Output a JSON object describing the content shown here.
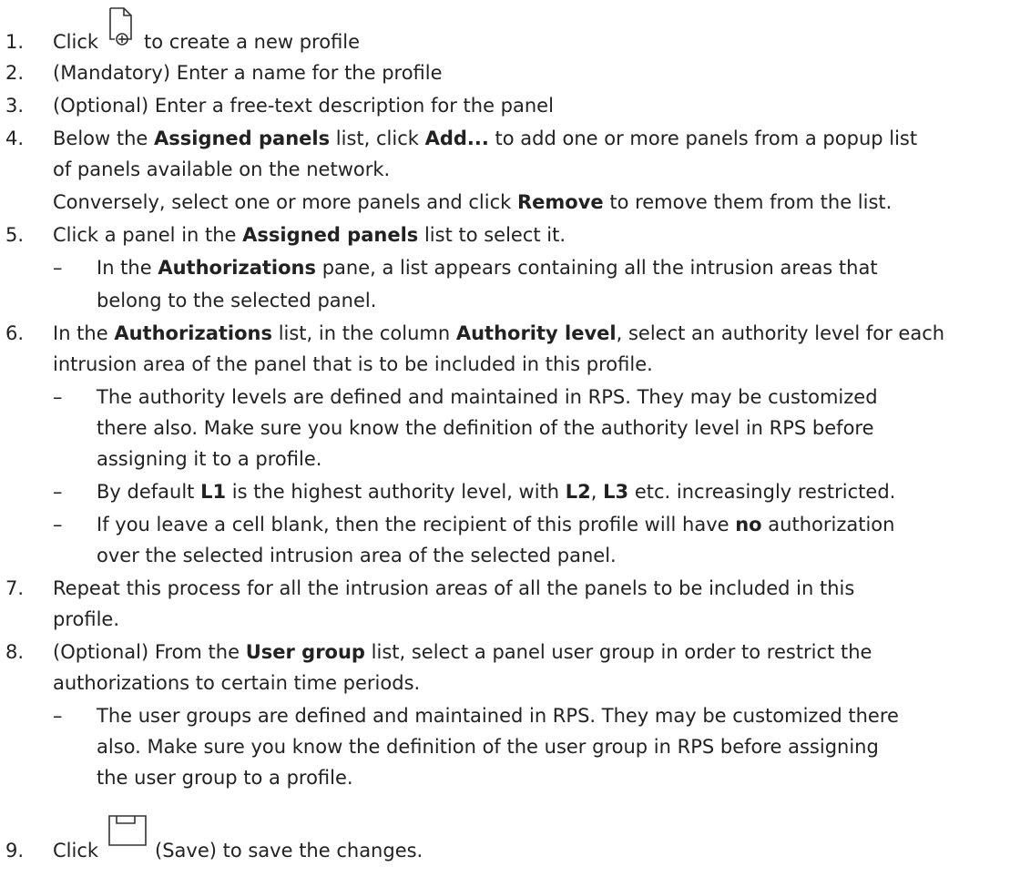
{
  "steps": [
    {
      "num": "1.",
      "parts": {
        "a": "Click",
        "b": "to create a new profile"
      },
      "icon": "new-profile-icon"
    },
    {
      "num": "2.",
      "text": "(Mandatory) Enter a name for the profile"
    },
    {
      "num": "3.",
      "text": "(Optional) Enter a free-text description for the panel"
    },
    {
      "num": "4.",
      "l1": {
        "a": "Below the ",
        "b": "Assigned panels",
        "c": " list, click ",
        "d": "Add...",
        "e": " to add one or more panels from a popup list"
      },
      "l2": "of panels available on the network.",
      "l3": {
        "a": "Conversely, select one or more panels and click ",
        "b": "Remove",
        "c": " to remove them from the list."
      }
    },
    {
      "num": "5.",
      "l1": {
        "a": "Click a panel in the ",
        "b": "Assigned panels",
        "c": " list to select it."
      },
      "sub": [
        {
          "dash": "–",
          "l1": {
            "a": "In the ",
            "b": "Authorizations",
            "c": " pane, a list appears containing all the intrusion areas that"
          },
          "l2": "belong to the selected panel."
        }
      ]
    },
    {
      "num": "6.",
      "l1": {
        "a": "In the ",
        "b": "Authorizations",
        "c": " list, in the column ",
        "d": "Authority level",
        "e": ", select an authority level for each"
      },
      "l2": "intrusion area of the panel that is to be included in this profile.",
      "sub": [
        {
          "dash": "–",
          "l1": "The authority levels are defined and maintained in RPS. They may be customized",
          "l2": "there also. Make sure you know the definition of the authority level in RPS before",
          "l3": "assigning it to a profile."
        },
        {
          "dash": "–",
          "l1": {
            "a": "By default ",
            "b": "L1",
            "c": " is the highest authority level, with ",
            "d": "L2",
            "e": ", ",
            "f": "L3",
            "g": " etc. increasingly restricted."
          }
        },
        {
          "dash": "–",
          "l1": {
            "a": "If you leave a cell blank, then the recipient of this profile will have ",
            "b": "no",
            "c": " authorization"
          },
          "l2": "over the selected intrusion area of the selected panel."
        }
      ]
    },
    {
      "num": "7.",
      "l1": "Repeat this process for all the intrusion areas of all the panels to be included in this",
      "l2": "profile."
    },
    {
      "num": "8.",
      "l1": {
        "a": "(Optional) From the ",
        "b": "User group",
        "c": " list, select a panel user group in order to restrict the"
      },
      "l2": "authorizations to certain time periods.",
      "sub": [
        {
          "dash": "–",
          "l1": "The user groups are defined and maintained in RPS. They may be customized there",
          "l2": "also. Make sure you know the definition of the user group in RPS before assigning",
          "l3": "the user group to a profile."
        }
      ]
    },
    {
      "num": "9.",
      "parts": {
        "a": "Click",
        "b": "(Save) to save the changes."
      },
      "icon": "save-icon"
    }
  ]
}
